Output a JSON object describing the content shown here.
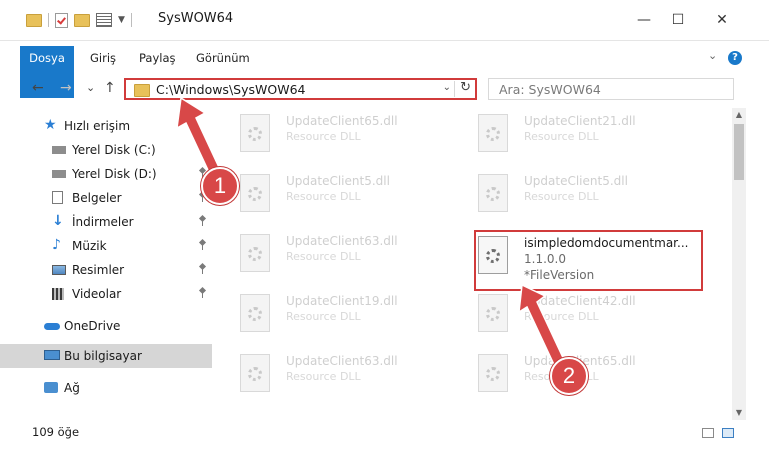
{
  "window": {
    "title": "SysWOW64",
    "minimize": "—",
    "maximize": "☐",
    "close": "✕"
  },
  "ribbon": {
    "tabs": [
      "Dosya",
      "Giriş",
      "Paylaş",
      "Görünüm"
    ],
    "expand": "⌄",
    "help": "?"
  },
  "navigation": {
    "back": "←",
    "forward": "→",
    "recent": "⌄",
    "up": "↑",
    "address": "C:\\Windows\\SysWOW64",
    "address_dropdown": "⌄",
    "refresh": "↻",
    "search_placeholder": "Ara: SysWOW64"
  },
  "sidebar": {
    "items": [
      {
        "label": "Hızlı erişim",
        "icon": "star-icon",
        "pinned": false
      },
      {
        "label": "Yerel Disk (C:)",
        "icon": "drive-icon",
        "pinned": true
      },
      {
        "label": "Yerel Disk (D:)",
        "icon": "drive-icon",
        "pinned": true
      },
      {
        "label": "Belgeler",
        "icon": "documents-icon",
        "pinned": true
      },
      {
        "label": "İndirmeler",
        "icon": "downloads-icon",
        "pinned": true
      },
      {
        "label": "Müzik",
        "icon": "music-icon",
        "pinned": true
      },
      {
        "label": "Resimler",
        "icon": "pictures-icon",
        "pinned": true
      },
      {
        "label": "Videolar",
        "icon": "videos-icon",
        "pinned": true
      },
      {
        "label": "OneDrive",
        "icon": "cloud-icon",
        "pinned": false
      },
      {
        "label": "Bu bilgisayar",
        "icon": "computer-icon",
        "pinned": false
      },
      {
        "label": "Ağ",
        "icon": "network-icon",
        "pinned": false
      }
    ]
  },
  "files": {
    "col1": [
      {
        "name": "UpdateClient65.dll",
        "type": "Resource DLL"
      },
      {
        "name": "UpdateClient5.dll",
        "type": "Resource DLL"
      },
      {
        "name": "UpdateClient63.dll",
        "type": "Resource DLL"
      },
      {
        "name": "UpdateClient19.dll",
        "type": "Resource DLL"
      },
      {
        "name": "UpdateClient63.dll",
        "type": "Resource DLL"
      }
    ],
    "col2": [
      {
        "name": "UpdateClient21.dll",
        "type": "Resource DLL"
      },
      {
        "name": "UpdateClient5.dll",
        "type": "Resource DLL"
      },
      {
        "name": "isimpledomdocumentmar...",
        "version": "1.1.0.0",
        "type": "*FileVersion"
      },
      {
        "name": "UpdateClient42.dll",
        "type": "Resource DLL"
      },
      {
        "name": "UpdateClient65.dll",
        "type": "Resource DLL"
      }
    ]
  },
  "status": {
    "item_count": "109 öğe"
  },
  "annotations": {
    "callout1": "1",
    "callout2": "2",
    "color": "#d84848"
  },
  "colors": {
    "accent": "#1979ca",
    "highlight_border": "#d13b3b",
    "selected_nav": "#d6d6d6"
  }
}
